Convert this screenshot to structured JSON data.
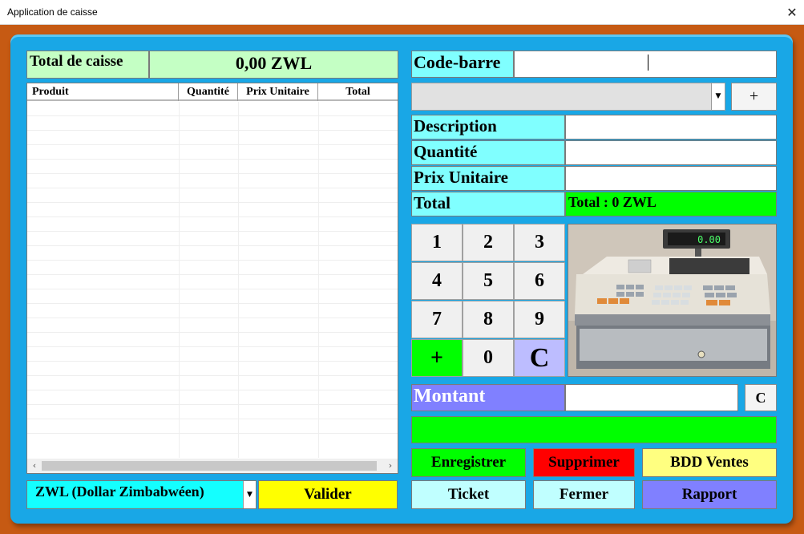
{
  "window": {
    "title": "Application de caisse",
    "close_glyph": "✕"
  },
  "total_caisse": {
    "label": "Total de caisse",
    "value": "0,00 ZWL"
  },
  "grid": {
    "columns": [
      "Produit",
      "Quantité",
      "Prix Unitaire",
      "Total"
    ],
    "scroll_left": "‹",
    "scroll_right": "›"
  },
  "currency": {
    "selected": "ZWL (Dollar Zimbabwéen)",
    "arrow": "▼"
  },
  "valider_label": "Valider",
  "barcode": {
    "label": "Code-barre",
    "value": ""
  },
  "product_combo": {
    "selected": "",
    "arrow": "▼"
  },
  "add_label": "+",
  "fields": {
    "description": {
      "label": "Description",
      "value": ""
    },
    "quantite": {
      "label": "Quantité",
      "value": ""
    },
    "prix_unitaire": {
      "label": "Prix Unitaire",
      "value": ""
    },
    "total": {
      "label": "Total",
      "value": "Total : 0 ZWL"
    }
  },
  "keypad": [
    "1",
    "2",
    "3",
    "4",
    "5",
    "6",
    "7",
    "8",
    "9",
    "+",
    "0",
    "C"
  ],
  "register_display": "0.00",
  "montant": {
    "label": "Montant",
    "value": "",
    "clear_label": "C"
  },
  "actions": {
    "enregistrer": "Enregistrer",
    "supprimer": "Supprimer",
    "bdd_ventes": "BDD Ventes",
    "ticket": "Ticket",
    "fermer": "Fermer",
    "rapport": "Rapport"
  },
  "colors": {
    "frame": "#c65a13",
    "panel": "#19a7e6",
    "label_cyan": "#80ffff",
    "green": "#00ff00",
    "yellow": "#ffff00",
    "red": "#ff0000",
    "violet": "#8080ff"
  }
}
